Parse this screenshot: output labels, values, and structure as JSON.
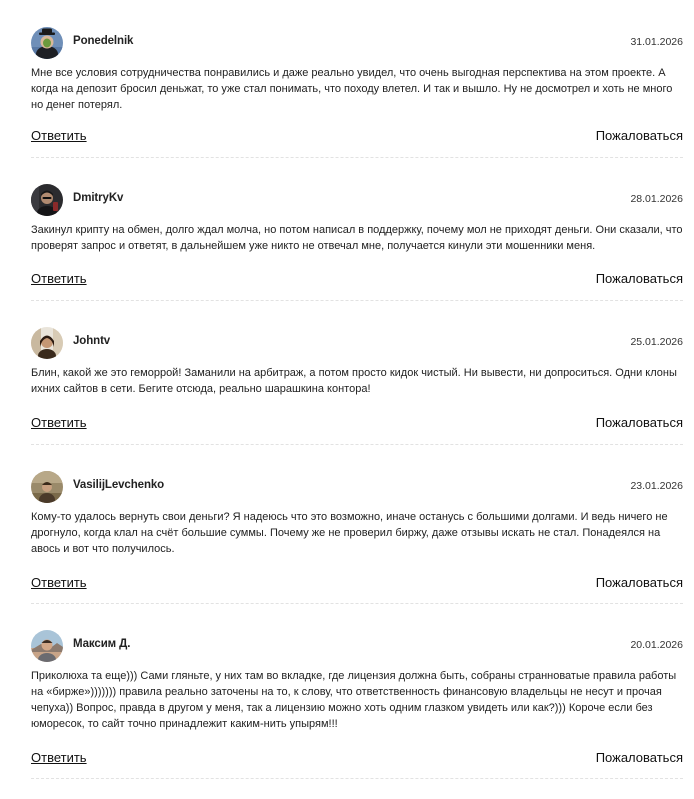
{
  "comments": [
    {
      "author": "Ponedelnik",
      "date": "31.01.2026",
      "text": "Мне все условия сотрудничества понравились и даже реально увидел, что очень выгодная перспектива на этом проекте. А когда на депозит бросил деньжат, то уже стал понимать, что походу влетел. И так и вышло. Ну не досмотрел и хоть не много но денег потерял.",
      "reply_label": "Ответить",
      "report_label": "Пожаловаться"
    },
    {
      "author": "DmitryKv",
      "date": "28.01.2026",
      "text": "Закинул крипту на обмен, долго ждал молча, но потом написал в поддержку, почему мол не приходят деньги. Они сказали, что проверят запрос и ответят, в дальнейшем уже никто не отвечал мне, получается кинули эти мошенники меня.",
      "reply_label": "Ответить",
      "report_label": "Пожаловаться"
    },
    {
      "author": "Johntv",
      "date": "25.01.2026",
      "text": "Блин, какой же это геморрой! Заманили на арбитраж, а потом просто кидок чистый. Ни вывести, ни допроситься. Одни клоны ихних сайтов в сети. Бегите отсюда, реально шарашкина контора!",
      "reply_label": "Ответить",
      "report_label": "Пожаловаться"
    },
    {
      "author": "VasilijLevchenko",
      "date": "23.01.2026",
      "text": "Кому-то удалось вернуть свои деньги? Я надеюсь что это возможно, иначе останусь с большими долгами. И ведь ничего не дрогнуло, когда клал на счёт большие суммы. Почему же не проверил биржу, даже отзывы искать не стал. Понадеялся на авось и вот что получилось.",
      "reply_label": "Ответить",
      "report_label": "Пожаловаться"
    },
    {
      "author": "Максим Д.",
      "date": "20.01.2026",
      "text": "Приколюха та еще))) Сами гляньте, у них там во вкладке, где лицензия должна быть, собраны странноватые правила работы на «бирже»))))))) правила реально заточены на то, к слову, что ответственность финансовую владельцы не несут и прочая чепуха)) Вопрос, правда в другом у меня, так а лицензию можно хоть одним глазком увидеть или как?))) Короче если без юморесок, то сайт точно принадлежит каким-нить упырям!!!",
      "reply_label": "Ответить",
      "report_label": "Пожаловаться"
    }
  ]
}
